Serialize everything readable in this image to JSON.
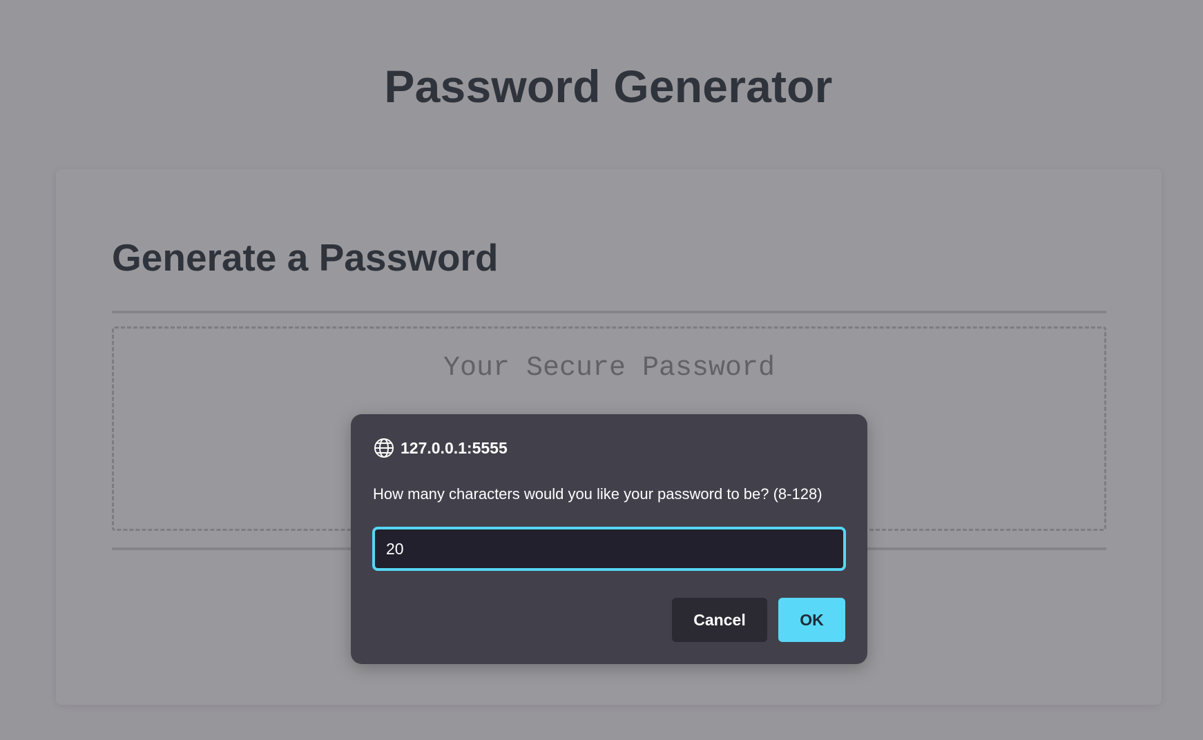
{
  "page": {
    "title": "Password Generator"
  },
  "card": {
    "header_title": "Generate a Password",
    "password_placeholder": "Your Secure Password"
  },
  "dialog": {
    "origin": "127.0.0.1:5555",
    "origin_icon": "globe-icon",
    "message": "How many characters would you like your password to be? (8-128)",
    "input_value": "20",
    "cancel_label": "Cancel",
    "ok_label": "OK"
  },
  "colors": {
    "background_dimmed": "#97969b",
    "dialog_bg": "#42414b",
    "input_bg": "#21202c",
    "input_focus_border": "#55d6f6",
    "ok_button": "#5ad8f8",
    "cancel_button": "#2b2a33",
    "heading_text": "#2f333b"
  }
}
